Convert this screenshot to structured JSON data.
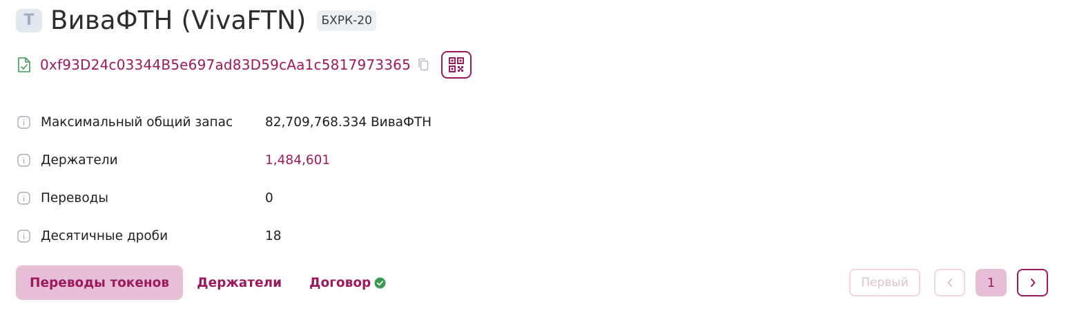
{
  "token": {
    "avatar_letter": "T",
    "title": "ВиваФТН (VivaFTN)",
    "standard": "БХРК-20"
  },
  "contract": {
    "address": "0xf93D24c03344B5e697ad83D59cAa1c5817973365",
    "icon": "file-check-icon",
    "copy_icon": "copy-icon",
    "qr_icon": "qr-code-icon"
  },
  "details": [
    {
      "label": "Максимальный общий запас",
      "value": "82,709,768.334 ВиваФТН"
    },
    {
      "label": "Держатели",
      "value": "1,484,601"
    },
    {
      "label": "Переводы",
      "value": "0"
    },
    {
      "label": "Десятичные дроби",
      "value": "18"
    }
  ],
  "tabs": [
    {
      "label": "Переводы токенов",
      "active": true
    },
    {
      "label": "Держатели",
      "active": false
    },
    {
      "label": "Договор",
      "active": false,
      "verified": true
    }
  ],
  "pagination": {
    "first_label": "Первый",
    "current_page": "1"
  },
  "colors": {
    "accent": "#9b1a5c",
    "accent_light": "#e6bfd6",
    "verified_green": "#3a9a55"
  }
}
